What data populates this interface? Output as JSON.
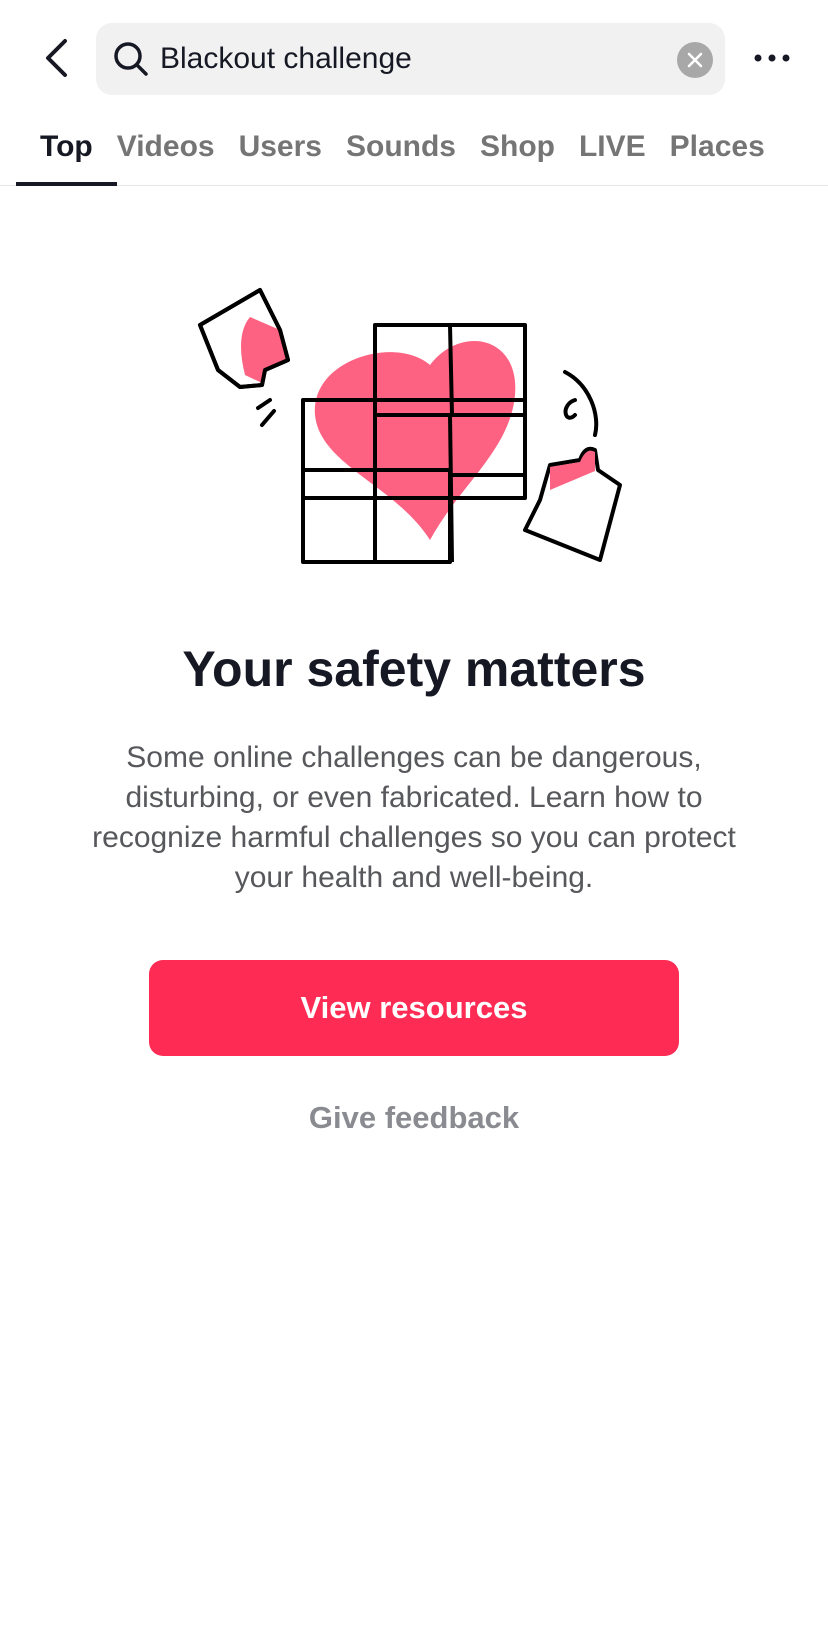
{
  "header": {
    "back_icon": "chevron-left-icon",
    "search_icon": "search-icon",
    "query": "Blackout challenge",
    "clear_icon": "clear-circle-icon",
    "more_icon": "more-horizontal-icon"
  },
  "tabs": [
    {
      "label": "Top",
      "active": true
    },
    {
      "label": "Videos"
    },
    {
      "label": "Users"
    },
    {
      "label": "Sounds"
    },
    {
      "label": "Shop"
    },
    {
      "label": "LIVE"
    },
    {
      "label": "Places"
    }
  ],
  "main": {
    "illustration": "heart-puzzle-illustration",
    "title": "Your safety matters",
    "description": "Some online challenges can be dangerous, disturbing, or even fabricated. Learn how to recognize harmful challenges so you can protect your health and well-being.",
    "primary_button": "View resources",
    "secondary_link": "Give feedback"
  },
  "colors": {
    "accent": "#fe2c55",
    "heart": "#fe6282",
    "text": "#161823"
  }
}
